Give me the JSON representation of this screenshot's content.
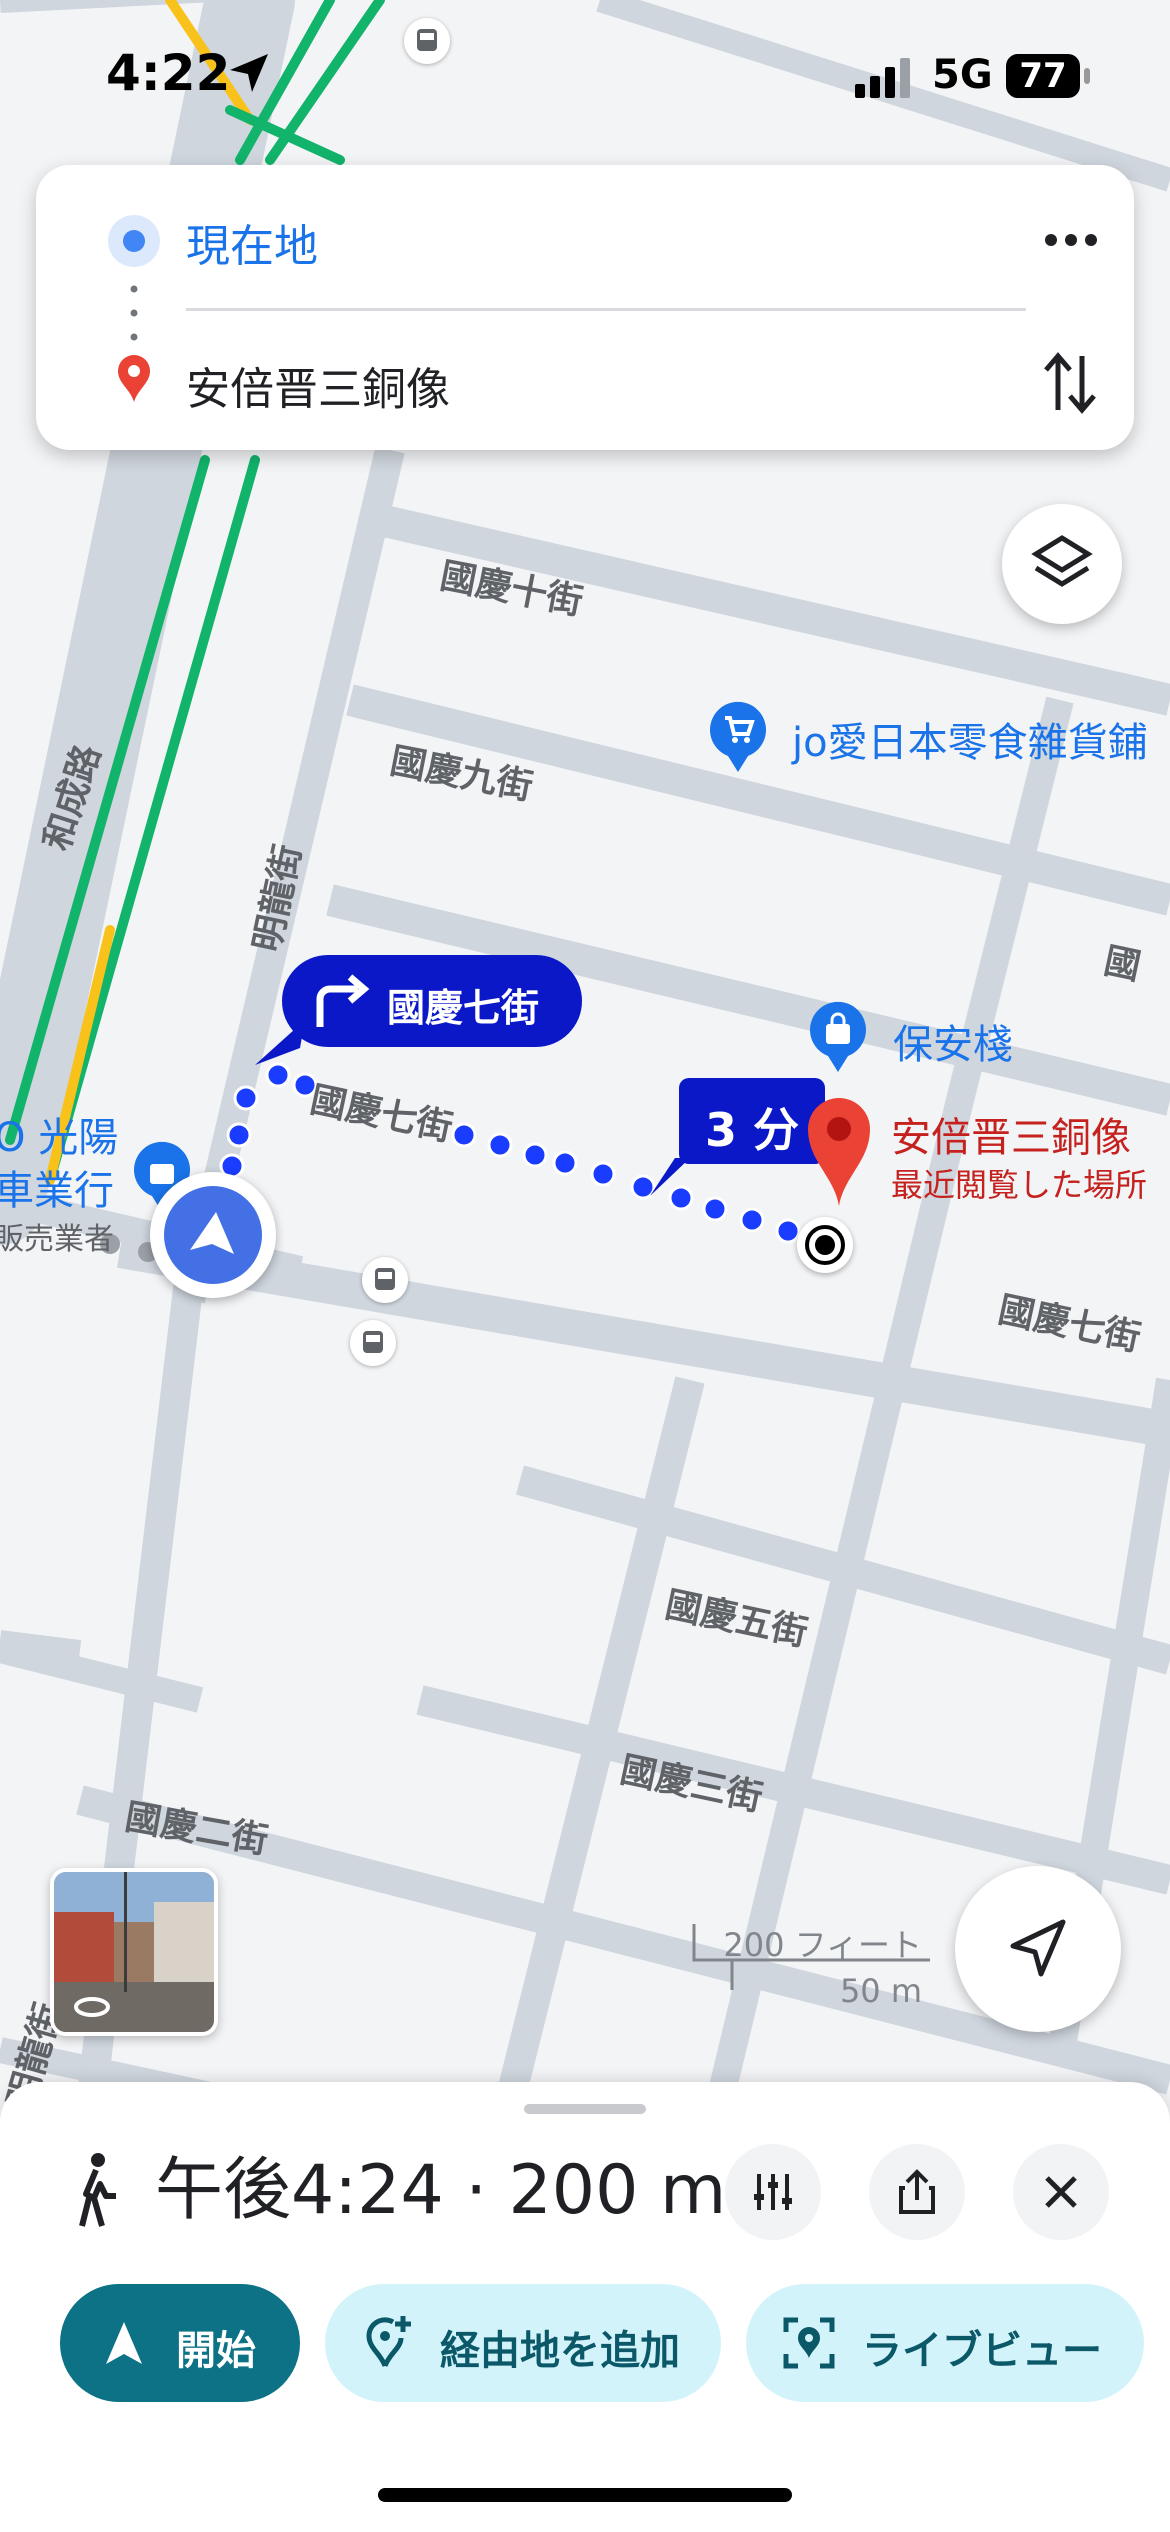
{
  "status_bar": {
    "time": "4:22",
    "network": "5G",
    "battery": "77"
  },
  "route": {
    "origin": "現在地",
    "destination": "安倍晋三銅像"
  },
  "map": {
    "streets": [
      "國慶十街",
      "國慶九街",
      "國慶七街",
      "國慶七街",
      "國慶五街",
      "國慶三街",
      "國慶二街",
      "明龍街",
      "和成路",
      "明龍街",
      "國"
    ],
    "pois": {
      "snack_shop": "jo愛日本零食雜貨鋪",
      "baoan": "保安棧",
      "guangyang_1": "O 光陽",
      "guangyang_2": "車業行",
      "guangyang_3": "販売業者"
    },
    "turn_instruction": "國慶七街",
    "eta_bubble": "3 分",
    "destination_name": "安倍晋三銅像",
    "destination_sub": "最近閲覧した場所",
    "scale_feet": "200 フィート",
    "scale_meters": "50 m"
  },
  "sheet": {
    "summary": "午後4:24 · 200 m",
    "start_label": "開始",
    "add_stop_label": "経由地を追加",
    "live_view_label": "ライブビュー"
  },
  "colors": {
    "route_blue": "#1a3cff",
    "bubble_blue": "#0b18c8",
    "start_teal": "#0d7285",
    "pill_light": "#d3f3fb",
    "dest_red": "#ea4335"
  },
  "icons": {
    "status": [
      "location-arrow-icon",
      "signal-icon",
      "battery-icon"
    ],
    "route_card": [
      "origin-dot-icon",
      "destination-pin-icon",
      "more-icon",
      "swap-icon"
    ],
    "map": [
      "layers-icon",
      "my-location-icon",
      "turn-right-icon",
      "shopping-cart-icon",
      "shopping-bag-icon",
      "bus-stop-icon",
      "navigation-cursor-icon",
      "destination-target-icon"
    ],
    "sheet": [
      "walk-icon",
      "options-icon",
      "share-icon",
      "close-icon",
      "navigate-icon",
      "add-stop-icon",
      "live-view-icon"
    ]
  }
}
